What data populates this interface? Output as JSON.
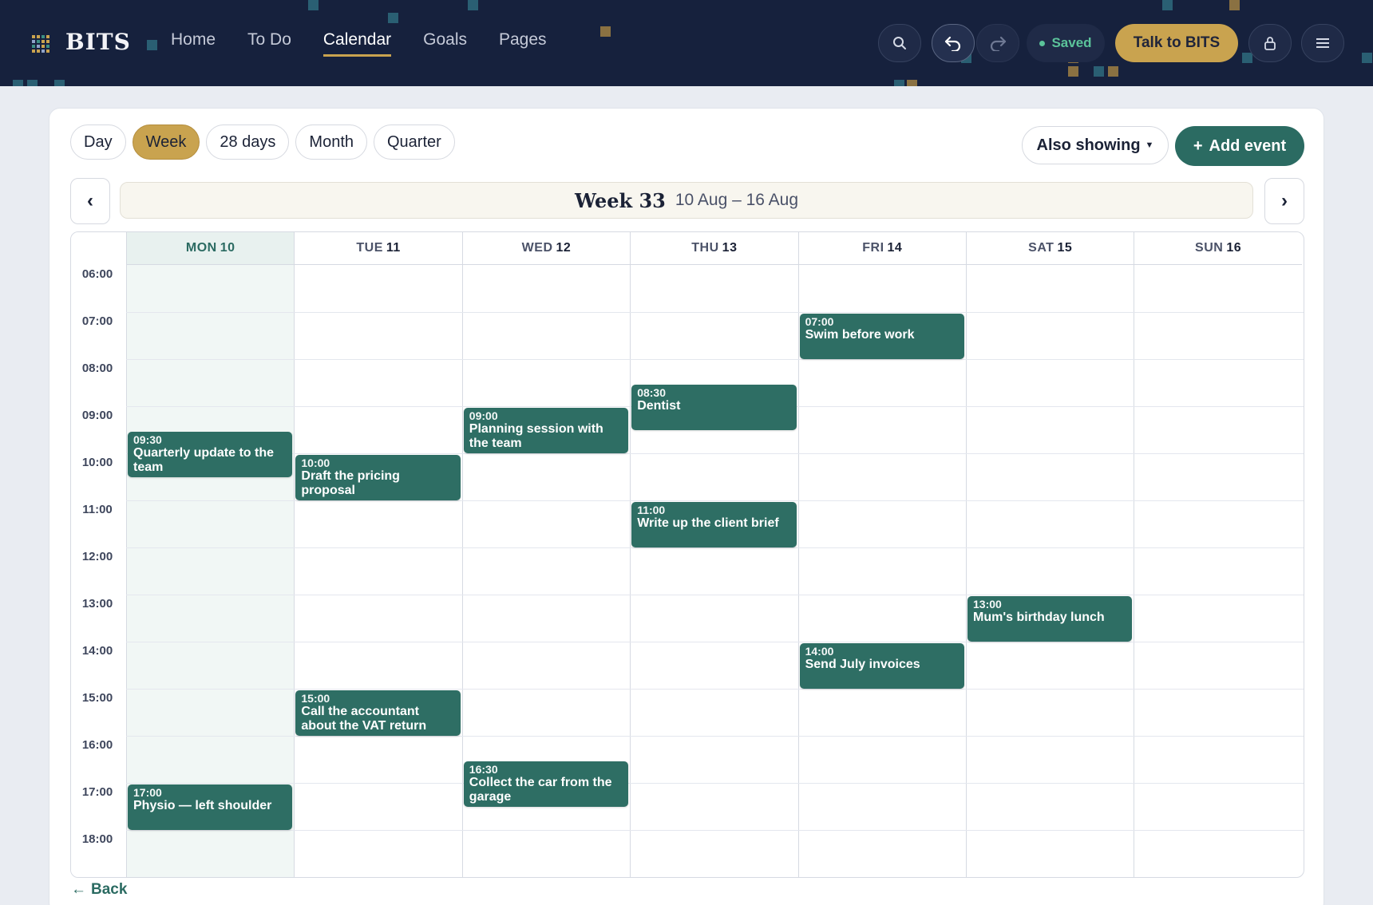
{
  "brand": {
    "name": "BITS"
  },
  "nav": {
    "items": [
      {
        "label": "Home",
        "active": false
      },
      {
        "label": "To Do",
        "active": false
      },
      {
        "label": "Calendar",
        "active": true
      },
      {
        "label": "Goals",
        "active": false
      },
      {
        "label": "Pages",
        "active": false
      }
    ]
  },
  "toolbar": {
    "saved_label": "Saved",
    "talk_label": "Talk to BITS",
    "icons": [
      "search-icon",
      "undo-icon",
      "redo-icon",
      "lock-icon",
      "menu-icon"
    ]
  },
  "views": {
    "items": [
      {
        "label": "Day",
        "active": false
      },
      {
        "label": "Week",
        "active": true
      },
      {
        "label": "28 days",
        "active": false
      },
      {
        "label": "Month",
        "active": false
      },
      {
        "label": "Quarter",
        "active": false
      }
    ]
  },
  "also_showing_label": "Also showing",
  "add_event_label": "Add event",
  "week": {
    "title": "Week 33",
    "range": "10 Aug – 16 Aug"
  },
  "days": [
    {
      "dow": "MON",
      "num": "10",
      "today": true
    },
    {
      "dow": "TUE",
      "num": "11",
      "today": false
    },
    {
      "dow": "WED",
      "num": "12",
      "today": false
    },
    {
      "dow": "THU",
      "num": "13",
      "today": false
    },
    {
      "dow": "FRI",
      "num": "14",
      "today": false
    },
    {
      "dow": "SAT",
      "num": "15",
      "today": false
    },
    {
      "dow": "SUN",
      "num": "16",
      "today": false
    }
  ],
  "hours": [
    "06:00",
    "07:00",
    "08:00",
    "09:00",
    "10:00",
    "11:00",
    "12:00",
    "13:00",
    "14:00",
    "15:00",
    "16:00",
    "17:00",
    "18:00"
  ],
  "events": [
    {
      "day": 0,
      "time": "09:30",
      "title": "Quarterly update to the team"
    },
    {
      "day": 0,
      "time": "17:00",
      "title": "Physio — left shoulder"
    },
    {
      "day": 1,
      "time": "10:00",
      "title": "Draft the pricing proposal"
    },
    {
      "day": 1,
      "time": "15:00",
      "title": "Call the accountant about the VAT return"
    },
    {
      "day": 2,
      "time": "09:00",
      "title": "Planning session with the team"
    },
    {
      "day": 2,
      "time": "16:30",
      "title": "Collect the car from the garage"
    },
    {
      "day": 3,
      "time": "08:30",
      "title": "Dentist"
    },
    {
      "day": 3,
      "time": "11:00",
      "title": "Write up the client brief"
    },
    {
      "day": 4,
      "time": "07:00",
      "title": "Swim before work"
    },
    {
      "day": 4,
      "time": "14:00",
      "title": "Send July invoices"
    },
    {
      "day": 5,
      "time": "13:00",
      "title": "Mum's birthday lunch"
    }
  ],
  "back_label": "Back",
  "colors": {
    "navy": "#16213d",
    "gold": "#c9a34f",
    "teal": "#2b6b62",
    "event": "#2e6e64",
    "saved": "#5bc39a"
  }
}
